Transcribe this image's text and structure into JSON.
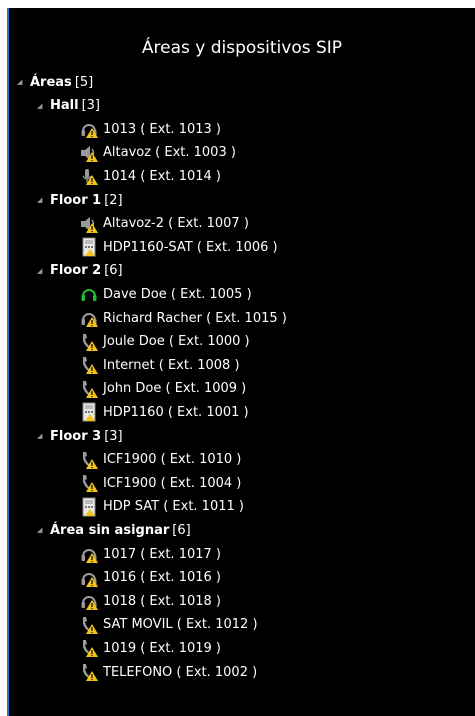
{
  "panel": {
    "title": "Áreas y dispositivos SIP"
  },
  "tree": {
    "root": {
      "label": "Áreas",
      "count": "[5]"
    },
    "groups": [
      {
        "label": "Hall",
        "count": "[3]",
        "devices": [
          {
            "label": "1013 ( Ext. 1013 )",
            "icon": "headset-warning-icon"
          },
          {
            "label": "Altavoz ( Ext. 1003 )",
            "icon": "speaker-warning-icon"
          },
          {
            "label": "1014 ( Ext. 1014 )",
            "icon": "microphone-warning-icon"
          }
        ]
      },
      {
        "label": "Floor 1",
        "count": "[2]",
        "devices": [
          {
            "label": "Altavoz-2 ( Ext. 1007 )",
            "icon": "speaker-warning-icon"
          },
          {
            "label": "HDP1160-SAT ( Ext. 1006 )",
            "icon": "intercom-panel-warning-icon"
          }
        ]
      },
      {
        "label": "Floor 2",
        "count": "[6]",
        "devices": [
          {
            "label": "Dave Doe ( Ext. 1005 )",
            "icon": "headset-online-icon"
          },
          {
            "label": "Richard Racher ( Ext. 1015 )",
            "icon": "headset-warning-icon"
          },
          {
            "label": "Joule Doe ( Ext. 1000 )",
            "icon": "phone-handset-warning-icon"
          },
          {
            "label": "Internet ( Ext. 1008 )",
            "icon": "phone-handset-warning-icon"
          },
          {
            "label": "John Doe ( Ext. 1009 )",
            "icon": "phone-handset-warning-icon"
          },
          {
            "label": "HDP1160 ( Ext. 1001 )",
            "icon": "intercom-panel-warning-icon"
          }
        ]
      },
      {
        "label": "Floor 3",
        "count": "[3]",
        "devices": [
          {
            "label": "ICF1900 ( Ext. 1010 )",
            "icon": "phone-handset-warning-icon"
          },
          {
            "label": "ICF1900 ( Ext. 1004 )",
            "icon": "phone-handset-warning-icon"
          },
          {
            "label": "HDP SAT ( Ext. 1011 )",
            "icon": "intercom-panel-warning-icon"
          }
        ]
      },
      {
        "label": "Área sin asignar",
        "count": "[6]",
        "devices": [
          {
            "label": "1017 ( Ext. 1017 )",
            "icon": "headset-warning-icon"
          },
          {
            "label": "1016 ( Ext. 1016 )",
            "icon": "headset-warning-icon"
          },
          {
            "label": "1018 ( Ext. 1018 )",
            "icon": "headset-warning-icon"
          },
          {
            "label": "SAT MOVIL ( Ext. 1012 )",
            "icon": "phone-handset-warning-icon"
          },
          {
            "label": "1019 ( Ext. 1019 )",
            "icon": "phone-handset-warning-icon"
          },
          {
            "label": "TELEFONO ( Ext. 1002 )",
            "icon": "phone-handset-warning-icon"
          }
        ]
      }
    ]
  },
  "colors": {
    "background": "#000000",
    "text": "#ffffff",
    "warning": "#f2c318",
    "online": "#1fbf2f",
    "device_gray": "#9a9a9a",
    "border": "#1e73c8"
  }
}
